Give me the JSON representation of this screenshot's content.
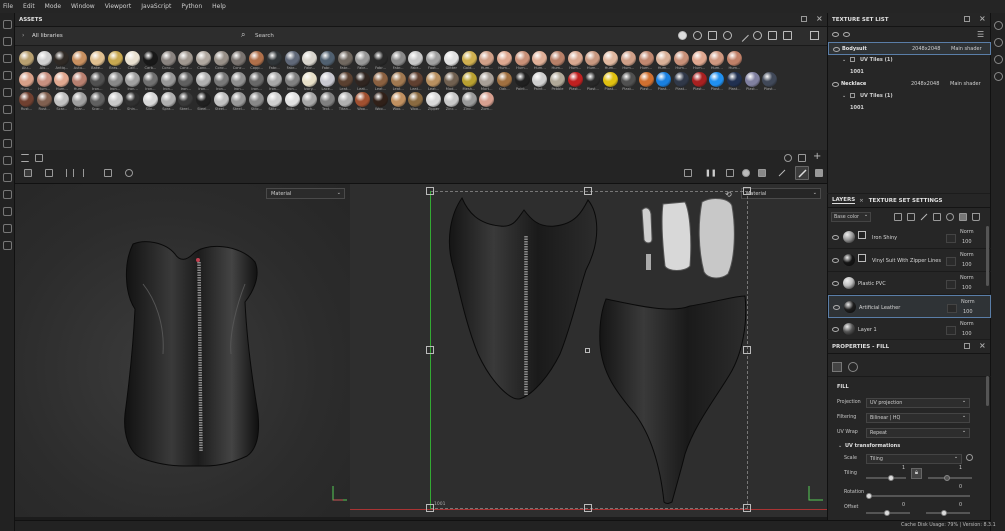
{
  "menu": [
    "File",
    "Edit",
    "Mode",
    "Window",
    "Viewport",
    "JavaScript",
    "Python",
    "Help"
  ],
  "assets": {
    "title": "ASSETS",
    "library": "All libraries",
    "search_placeholder": "Search",
    "rows": [
      [
        {
          "label": "Alu...",
          "color": "#b8a070"
        },
        {
          "label": "Alu...",
          "color": "#d0d0d0"
        },
        {
          "label": "Antiq...",
          "color": "#302a25"
        },
        {
          "label": "Autu...",
          "color": "#c89060"
        },
        {
          "label": "Bake...",
          "color": "#e0c090"
        },
        {
          "label": "Bras...",
          "color": "#c8a850"
        },
        {
          "label": "Calf...",
          "color": "#e8e0d0"
        },
        {
          "label": "Carb...",
          "color": "#181818"
        },
        {
          "label": "Conc...",
          "color": "#8a8480"
        },
        {
          "label": "Conc...",
          "color": "#a09890"
        },
        {
          "label": "Conc...",
          "color": "#b0a8a0"
        },
        {
          "label": "Conc...",
          "color": "#989088"
        },
        {
          "label": "Conc...",
          "color": "#7a7470"
        },
        {
          "label": "Copp...",
          "color": "#b0704a"
        },
        {
          "label": "Fabr...",
          "color": "#303538"
        },
        {
          "label": "Fabr...",
          "color": "#606878"
        },
        {
          "label": "Fabr...",
          "color": "#d8d4cc"
        },
        {
          "label": "Fabr...",
          "color": "#506070"
        },
        {
          "label": "Fabr...",
          "color": "#706860"
        },
        {
          "label": "Fabr...",
          "color": "#989898"
        },
        {
          "label": "Fabr...",
          "color": "#282828"
        },
        {
          "label": "Fabr...",
          "color": "#8a8a8a"
        },
        {
          "label": "Fabr...",
          "color": "#c8c8c8"
        },
        {
          "label": "Foot...",
          "color": "#a0a0a0"
        },
        {
          "label": "Glitter",
          "color": "#e0e0e0"
        },
        {
          "label": "Gold...",
          "color": "#d0b050"
        },
        {
          "label": "Hum...",
          "color": "#d0a088"
        },
        {
          "label": "Hum...",
          "color": "#dda890"
        },
        {
          "label": "Hum...",
          "color": "#c89078"
        },
        {
          "label": "Hum...",
          "color": "#e0b098"
        },
        {
          "label": "Hum...",
          "color": "#b88068"
        },
        {
          "label": "Hum...",
          "color": "#d8a890"
        },
        {
          "label": "Hum...",
          "color": "#c89880"
        },
        {
          "label": "Hum...",
          "color": "#e0b8a0"
        },
        {
          "label": "Hum...",
          "color": "#d0a088"
        },
        {
          "label": "Hum...",
          "color": "#c08870"
        },
        {
          "label": "Hum...",
          "color": "#d8b098"
        },
        {
          "label": "Hum...",
          "color": "#c89078"
        },
        {
          "label": "Hum...",
          "color": "#e0a890"
        },
        {
          "label": "Hum...",
          "color": "#d09880"
        },
        {
          "label": "Hum...",
          "color": "#c08068"
        }
      ],
      [
        {
          "label": "Hum...",
          "color": "#d8a088"
        },
        {
          "label": "Hum...",
          "color": "#c89080"
        },
        {
          "label": "Hum...",
          "color": "#e0a890"
        },
        {
          "label": "Hum...",
          "color": "#b88070"
        },
        {
          "label": "Iron...",
          "color": "#505050"
        },
        {
          "label": "Iron...",
          "color": "#888888"
        },
        {
          "label": "Iron...",
          "color": "#a0a0a0"
        },
        {
          "label": "Iron...",
          "color": "#707070"
        },
        {
          "label": "Iron...",
          "color": "#989898"
        },
        {
          "label": "Iron...",
          "color": "#606060"
        },
        {
          "label": "Iron...",
          "color": "#b0b0b0"
        },
        {
          "label": "Iron...",
          "color": "#787878"
        },
        {
          "label": "Iron...",
          "color": "#909090"
        },
        {
          "label": "Iron...",
          "color": "#686868"
        },
        {
          "label": "Iron...",
          "color": "#a8a8a8"
        },
        {
          "label": "Iron...",
          "color": "#808080"
        },
        {
          "label": "Ivory...",
          "color": "#e8e0c8"
        },
        {
          "label": "Lace...",
          "color": "#c8c8d0"
        },
        {
          "label": "Leat...",
          "color": "#5a4030"
        },
        {
          "label": "Leat...",
          "color": "#302520"
        },
        {
          "label": "Leat...",
          "color": "#8a6040"
        },
        {
          "label": "Leat...",
          "color": "#a07850"
        },
        {
          "label": "Leat...",
          "color": "#604030"
        },
        {
          "label": "Leat...",
          "color": "#b89060"
        },
        {
          "label": "Mad...",
          "color": "#706050"
        },
        {
          "label": "Mesh...",
          "color": "#b8a030"
        },
        {
          "label": "Mort...",
          "color": "#a8a098"
        },
        {
          "label": "Oak...",
          "color": "#a07040"
        },
        {
          "label": "Paint...",
          "color": "#202020"
        },
        {
          "label": "Paint...",
          "color": "#d0d0d0"
        },
        {
          "label": "Pebble",
          "color": "#b0a898"
        },
        {
          "label": "Plast...",
          "color": "#c02020"
        },
        {
          "label": "Plast...",
          "color": "#282828"
        },
        {
          "label": "Plast...",
          "color": "#e0c010"
        },
        {
          "label": "Plast...",
          "color": "#505050"
        },
        {
          "label": "Plast...",
          "color": "#d07030"
        },
        {
          "label": "Plast...",
          "color": "#1a80e0"
        },
        {
          "label": "Plast...",
          "color": "#303848"
        },
        {
          "label": "Plast...",
          "color": "#a82020"
        },
        {
          "label": "Plast...",
          "color": "#2090f0"
        },
        {
          "label": "Plast...",
          "color": "#203050"
        },
        {
          "label": "Plast...",
          "color": "#8080a0"
        },
        {
          "label": "Plast...",
          "color": "#404858"
        }
      ],
      [
        {
          "label": "Rust...",
          "color": "#704030"
        },
        {
          "label": "Rust...",
          "color": "#806050"
        },
        {
          "label": "Scar...",
          "color": "#c0c0c0"
        },
        {
          "label": "Scar...",
          "color": "#a0a0a0"
        },
        {
          "label": "Scar...",
          "color": "#606060"
        },
        {
          "label": "Scra...",
          "color": "#c8c8c8"
        },
        {
          "label": "Shin...",
          "color": "#303030"
        },
        {
          "label": "Silv...",
          "color": "#d8d8d8"
        },
        {
          "label": "Spra...",
          "color": "#b0b0b0"
        },
        {
          "label": "Steel...",
          "color": "#383838"
        },
        {
          "label": "Steel...",
          "color": "#202020"
        },
        {
          "label": "Steel...",
          "color": "#c0c0c0"
        },
        {
          "label": "Steel...",
          "color": "#989898"
        },
        {
          "label": "Stitc...",
          "color": "#888888"
        },
        {
          "label": "Stitc...",
          "color": "#d0d0d0"
        },
        {
          "label": "Stitc...",
          "color": "#e0e0e0"
        },
        {
          "label": "Tech...",
          "color": "#a8a8a8"
        },
        {
          "label": "Text...",
          "color": "#808080"
        },
        {
          "label": "Titan...",
          "color": "#b0b0b0"
        },
        {
          "label": "Woo...",
          "color": "#a05030"
        },
        {
          "label": "Woo...",
          "color": "#302018"
        },
        {
          "label": "Woo...",
          "color": "#c09060"
        },
        {
          "label": "Woo...",
          "color": "#8a6a40"
        },
        {
          "label": "Zipper",
          "color": "#d8d8d8"
        },
        {
          "label": "Zinc...",
          "color": "#c8c8c8"
        },
        {
          "label": "Zinc...",
          "color": "#9a9a9a"
        },
        {
          "label": "Zom...",
          "color": "#d8a090"
        }
      ]
    ]
  },
  "viewport": {
    "left_channel": "Material",
    "right_channel": "Material",
    "uv_tile_label": "1001"
  },
  "texture_set_list": {
    "title": "TEXTURE SET LIST",
    "sets": [
      {
        "name": "Bodysuit",
        "resolution": "2048x2048",
        "shader": "Main shader",
        "uv_tiles": "UV Tiles (1)",
        "tile": "1001"
      },
      {
        "name": "Necklace",
        "resolution": "2048x2048",
        "shader": "Main shader",
        "uv_tiles": "UV Tiles (1)",
        "tile": "1001"
      }
    ]
  },
  "layers": {
    "tab_layers": "LAYERS",
    "tab_settings": "TEXTURE SET SETTINGS",
    "channel": "Base color",
    "items": [
      {
        "name": "Iron Shiny",
        "blend": "Norm",
        "opacity": "100",
        "color": "#9a9a9a"
      },
      {
        "name": "Vinyl Suit With Zipper Lines",
        "blend": "Norm",
        "opacity": "100",
        "color": "#151515"
      },
      {
        "name": "Plastic PVC",
        "blend": "Norm",
        "opacity": "100",
        "color": "#bdbdbd"
      },
      {
        "name": "Artificial Leather",
        "blend": "Norm",
        "opacity": "100",
        "color": "#1e1e1e"
      },
      {
        "name": "Layer 1",
        "blend": "Norm",
        "opacity": "100",
        "color": "#555"
      }
    ]
  },
  "properties": {
    "title": "PROPERTIES - FILL",
    "section": "FILL",
    "projection_label": "Projection",
    "projection_value": "UV projection",
    "filtering_label": "Filtering",
    "filtering_value": "Bilinear | HQ",
    "uvwrap_label": "UV Wrap",
    "uvwrap_value": "Repeat",
    "uvt_title": "UV transformations",
    "scale_label": "Scale",
    "scale_value": "Tiling",
    "tiling_label": "Tiling",
    "tiling_value": "1",
    "tiling_value2": "1",
    "rotation_label": "Rotation",
    "rotation_value": "0",
    "offset_label": "Offset",
    "offset_value": "0",
    "offset_value2": "0"
  },
  "status": {
    "cache": "Cache Disk Usage: 79% | Version: 8.3.1"
  }
}
